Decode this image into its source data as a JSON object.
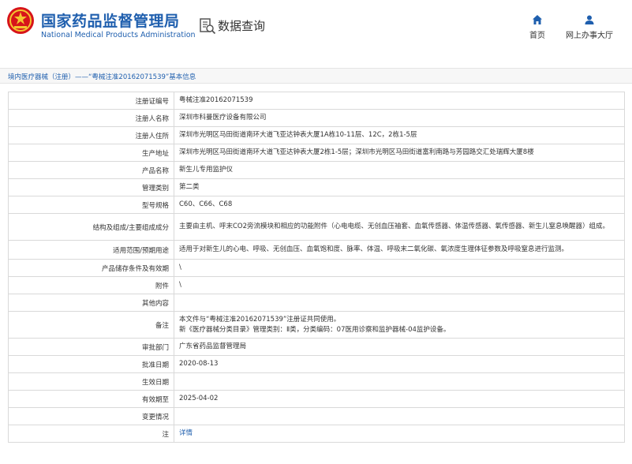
{
  "header": {
    "site_name_cn": "国家药品监督管理局",
    "site_name_en": "National Medical Products Administration",
    "search_title": "数据查询",
    "nav": [
      {
        "label": "首页",
        "icon": "home-icon"
      },
      {
        "label": "网上办事大厅",
        "icon": "user-icon"
      }
    ]
  },
  "breadcrumb": "境内医疗器械（注册）——“粤械注准20162071539”基本信息",
  "record": {
    "reg_no": {
      "label": "注册证编号",
      "value": "粤械注准20162071539"
    },
    "registrant": {
      "label": "注册人名称",
      "value": "深圳市科曼医疗设备有限公司"
    },
    "registrant_addr": {
      "label": "注册人住所",
      "value": "深圳市光明区马田街道南环大道飞亚达钟表大厦1A栋10-11层、12C，2栋1-5层"
    },
    "production_addr": {
      "label": "生产地址",
      "value": "深圳市光明区马田街道南环大道飞亚达钟表大厦2栋1-5层；深圳市光明区马田街道富利南路与芳园路交汇处瑞辉大厦8楼"
    },
    "product_name": {
      "label": "产品名称",
      "value": "新生儿专用监护仪"
    },
    "mgmt_class": {
      "label": "管理类别",
      "value": "第二类"
    },
    "model": {
      "label": "型号规格",
      "value": "C60、C66、C68"
    },
    "structure": {
      "label": "结构及组成/主要组成成分",
      "value": "主要由主机、呼末CO2旁流模块和相应的功能附件（心电电缆、无创血压袖套、血氧传感器、体温传感器、氧传感器、新生儿窒息唤醒器）组成。"
    },
    "scope": {
      "label": "适用范围/预期用途",
      "value": "适用于对新生儿的心电、呼吸、无创血压、血氧饱和度、脉率、体温、呼吸末二氧化碳、氧浓度生理体征参数及呼吸窒息进行监测。"
    },
    "storage": {
      "label": "产品储存条件及有效期",
      "value": "\\"
    },
    "accessories": {
      "label": "附件",
      "value": "\\"
    },
    "other": {
      "label": "其他内容",
      "value": ""
    },
    "remark": {
      "label": "备注",
      "line1": "本文件与“粤械注准20162071539”注册证共同使用。",
      "line2": "新《医疗器械分类目录》管理类别：Ⅱ类，分类编码：07医用诊察和监护器械-04监护设备。"
    },
    "approval_dept": {
      "label": "审批部门",
      "value": "广东省药品监督管理局"
    },
    "approval_date": {
      "label": "批准日期",
      "value": "2020-08-13"
    },
    "effective_date": {
      "label": "生效日期",
      "value": ""
    },
    "valid_until": {
      "label": "有效期至",
      "value": "2025-04-02"
    },
    "changes": {
      "label": "变更情况",
      "value": ""
    },
    "note": {
      "label": "注",
      "value": "详情"
    }
  },
  "colors": {
    "brand": "#1f5fae",
    "emblem_red": "#d7141a",
    "emblem_gold": "#f4c430"
  }
}
